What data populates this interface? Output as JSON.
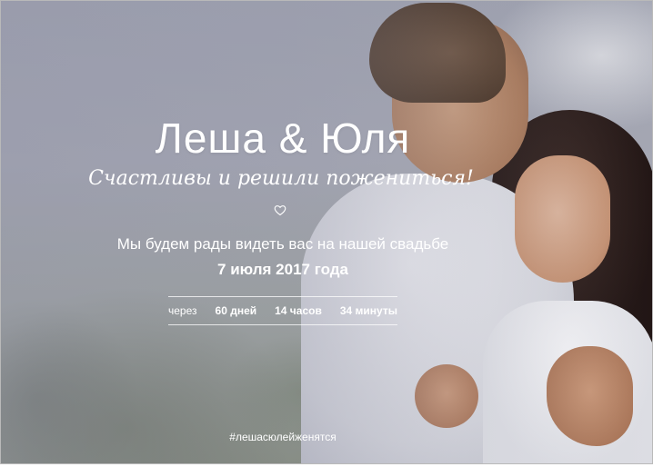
{
  "hero": {
    "names": "Леша & Юля",
    "tagline": "Счастливы и решили пожениться!",
    "heart_icon": "heart-outline-icon",
    "invitation": "Мы будем рады видеть вас на нашей свадьбе",
    "date": "7 июля 2017 года",
    "countdown": {
      "prefix": "через",
      "days": "60 дней",
      "hours": "14 часов",
      "minutes": "34 минуты"
    },
    "hashtag": "#лешасюлейженятся"
  },
  "colors": {
    "text": "#ffffff",
    "overlay": "#9698aa",
    "border": "#b9b9b9"
  }
}
